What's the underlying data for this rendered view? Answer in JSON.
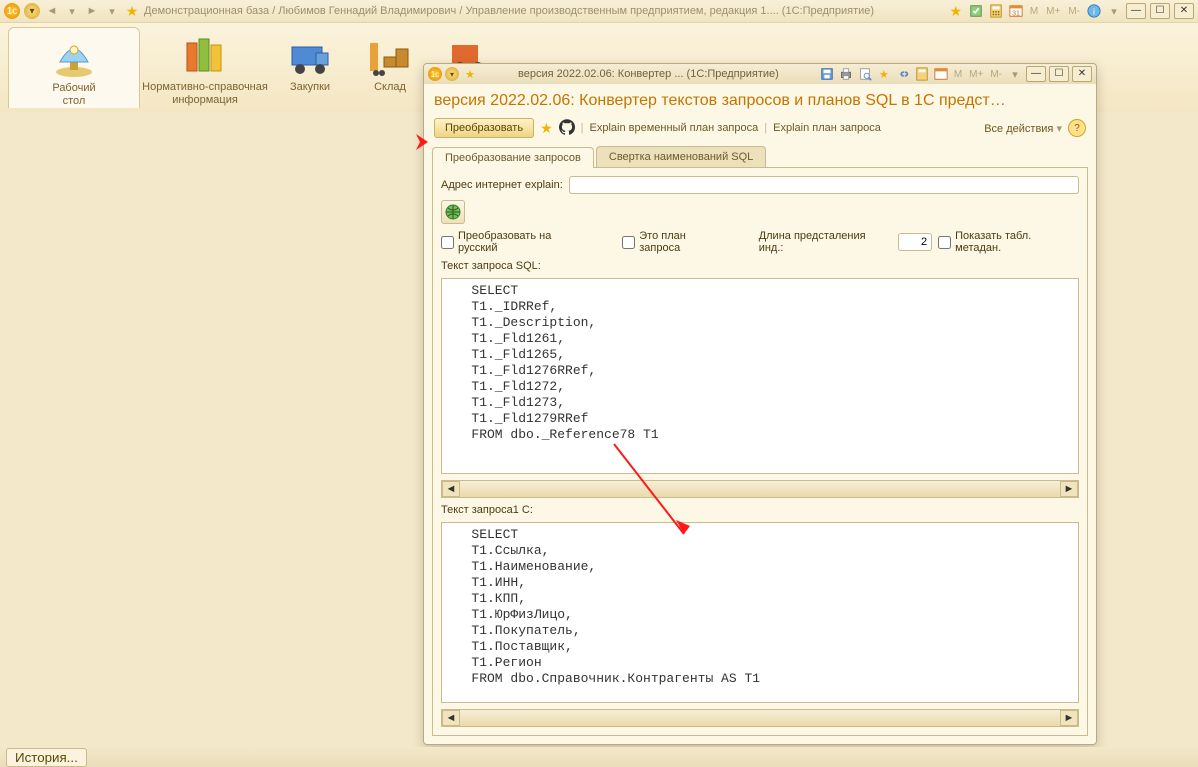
{
  "app": {
    "title": "Демонстрационная база / Любимов Геннадий Владимирович / Управление производственным предприятием, редакция 1....   (1С:Предприятие)"
  },
  "titlebar_icons": {
    "m": "M",
    "m_plus": "M+",
    "m_minus": "M-"
  },
  "sections": {
    "desktop": "Рабочий\nстол",
    "nsi": "Нормативно-справочная\nинформация",
    "purchases": "Закупки",
    "warehouse": "Склад"
  },
  "modal": {
    "window_title": "версия 2022.02.06: Конвертер ...  (1С:Предприятие)",
    "main_title": "версия 2022.02.06: Конвертер текстов запросов и планов SQL в 1С предст…",
    "btn_transform": "Преобразовать",
    "link_explain_temp": "Explain временный план запроса",
    "link_explain_plan": "Explain план запроса",
    "all_actions": "Все действия",
    "tabs": {
      "convert": "Преобразование запросов",
      "rollup": "Свертка наименований SQL"
    },
    "addr_label": "Адрес интернет explain:",
    "addr_value": "",
    "chk_to_russian": "Преобразовать на русский",
    "chk_is_plan": "Это план запроса",
    "len_label": "Длина предсталения инд.:",
    "len_value": "2",
    "chk_show_meta": "Показать табл. метадан.",
    "sql_label": "Текст запроса SQL:",
    "sql_text": "   SELECT\n   T1._IDRRef,\n   T1._Description,\n   T1._Fld1261,\n   T1._Fld1265,\n   T1._Fld1276RRef,\n   T1._Fld1272,\n   T1._Fld1273,\n   T1._Fld1279RRef\n   FROM dbo._Reference78 T1",
    "onec_label": "Текст запроса1 С:",
    "onec_text": "   SELECT\n   T1.Ссылка,\n   T1.Наименование,\n   T1.ИНН,\n   T1.КПП,\n   T1.ЮрФизЛицо,\n   T1.Покупатель,\n   T1.Поставщик,\n   T1.Регион\n   FROM dbo.Справочник.Контрагенты AS T1"
  },
  "status": {
    "history": "История..."
  }
}
